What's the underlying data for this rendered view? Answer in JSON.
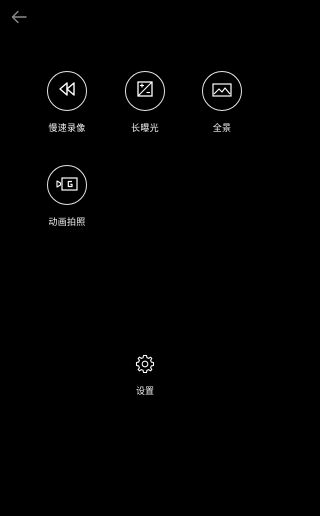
{
  "header": {
    "back_icon": "arrow-left-icon"
  },
  "modes": [
    {
      "label": "慢速录像",
      "icon": "rewind-icon"
    },
    {
      "label": "长曝光",
      "icon": "exposure-icon"
    },
    {
      "label": "全景",
      "icon": "landscape-icon"
    },
    {
      "label": "动画拍照",
      "icon": "gif-camera-icon"
    }
  ],
  "settings": {
    "label": "设置",
    "icon": "gear-icon"
  },
  "colors": {
    "background": "#000000",
    "foreground": "#ffffff",
    "back_arrow": "#8c8c8c"
  }
}
